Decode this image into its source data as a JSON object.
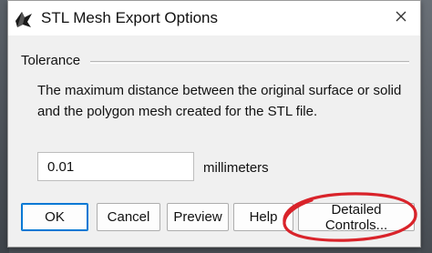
{
  "window": {
    "title": "STL Mesh Export Options",
    "app_icon": "rhino-icon",
    "close_icon": "close-icon"
  },
  "tolerance_group": {
    "label": "Tolerance",
    "description": "The maximum distance between the original surface or solid and the polygon mesh created for the STL file."
  },
  "tolerance_field": {
    "value": "0.01",
    "unit": "millimeters"
  },
  "buttons": {
    "ok": "OK",
    "cancel": "Cancel",
    "preview": "Preview",
    "help": "Help",
    "detailed": "Detailed Controls..."
  },
  "colors": {
    "annotation": "#d9232a",
    "focus_accent": "#0078d4"
  }
}
